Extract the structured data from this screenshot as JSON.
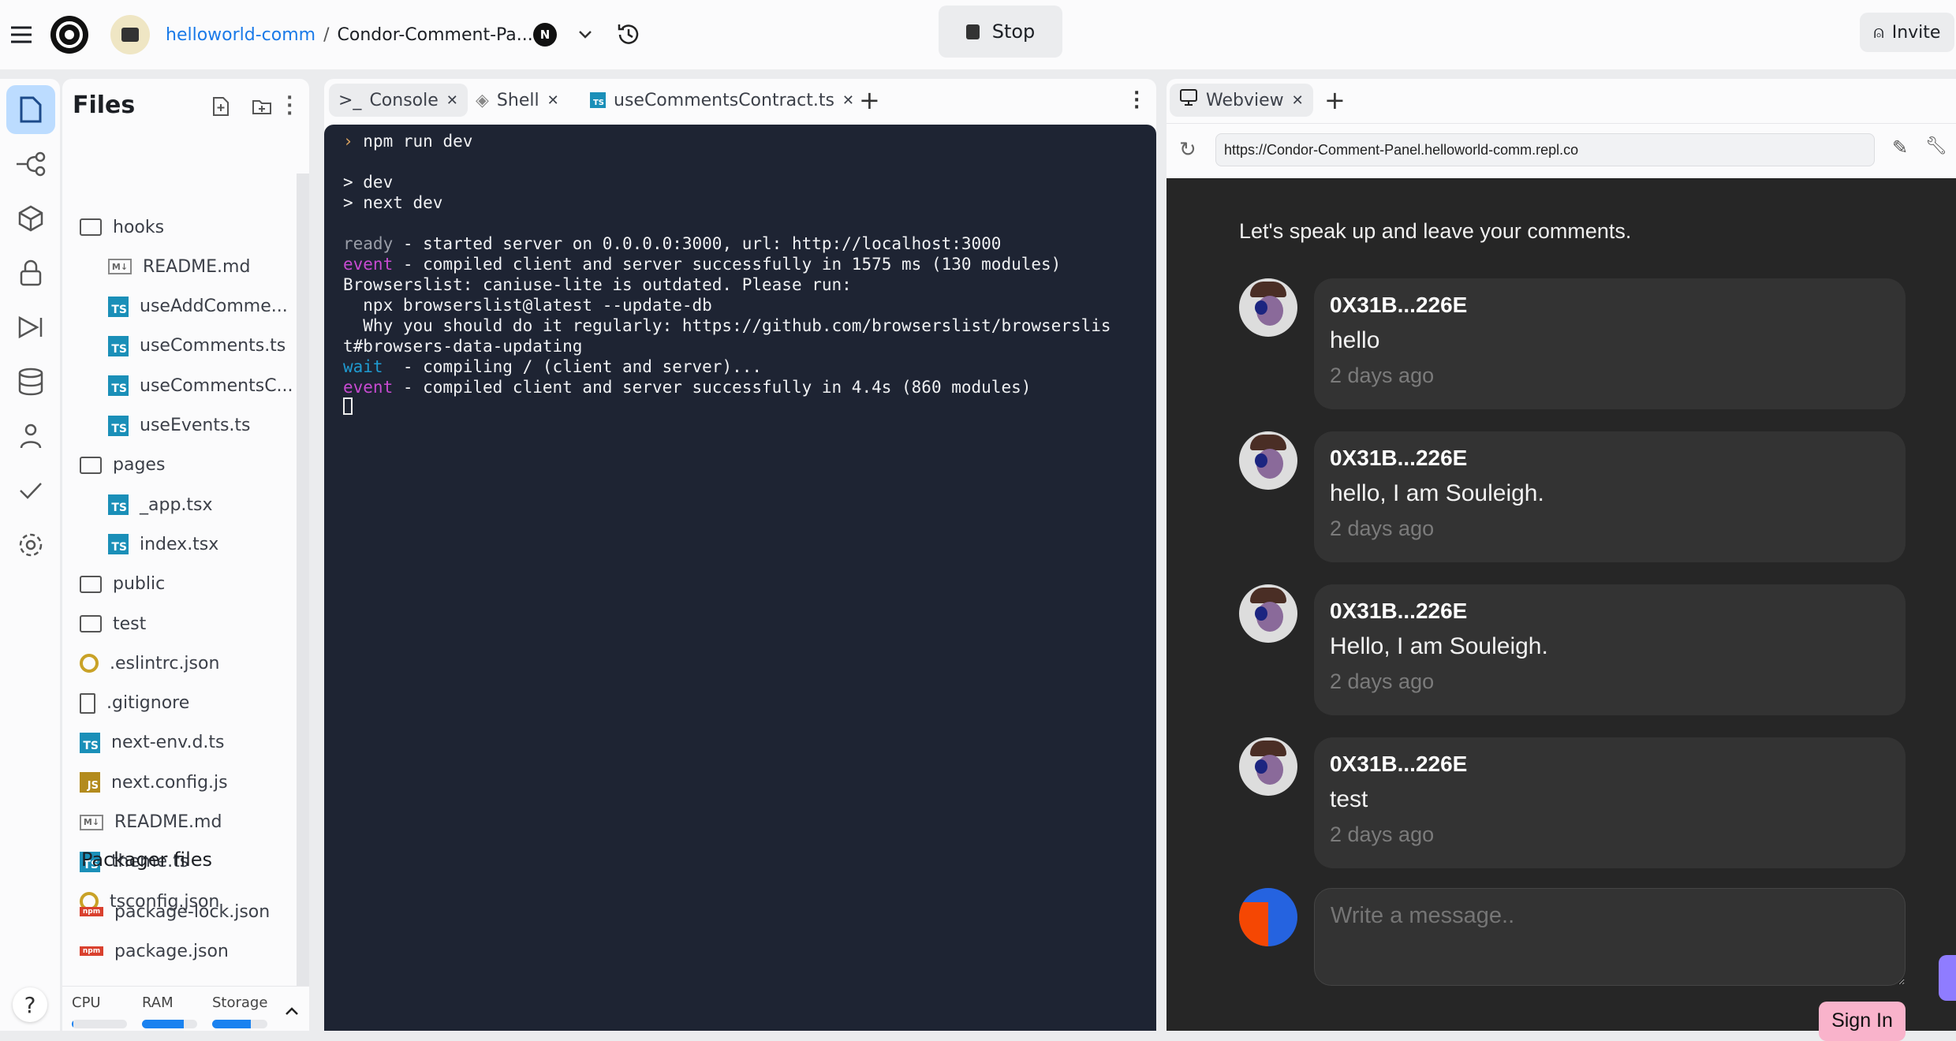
{
  "topbar": {
    "workspace": "helloworld-comm",
    "separator": "/",
    "repl_name": "Condor-Comment-Pa...",
    "nix_badge": "N",
    "stop_label": "Stop",
    "invite_label": "Invite"
  },
  "rail": {
    "icons": [
      "file-icon",
      "git-icon",
      "package-icon",
      "lock-icon",
      "debugger-icon",
      "database-icon",
      "user-icon",
      "check-icon",
      "settings-icon"
    ],
    "help": "?"
  },
  "files": {
    "title": "Files",
    "items": [
      {
        "name": "hooks",
        "type": "folder",
        "indent": 0
      },
      {
        "name": "README.md",
        "type": "md",
        "indent": 1
      },
      {
        "name": "useAddComme...",
        "type": "ts",
        "indent": 1
      },
      {
        "name": "useComments.ts",
        "type": "ts",
        "indent": 1
      },
      {
        "name": "useCommentsC...",
        "type": "ts",
        "indent": 1
      },
      {
        "name": "useEvents.ts",
        "type": "ts",
        "indent": 1
      },
      {
        "name": "pages",
        "type": "folder",
        "indent": 0
      },
      {
        "name": "_app.tsx",
        "type": "ts",
        "indent": 1
      },
      {
        "name": "index.tsx",
        "type": "ts",
        "indent": 1
      },
      {
        "name": "public",
        "type": "folder",
        "indent": 0
      },
      {
        "name": "test",
        "type": "folder",
        "indent": 0
      },
      {
        "name": ".eslintrc.json",
        "type": "json",
        "indent": 0
      },
      {
        "name": ".gitignore",
        "type": "file",
        "indent": 0
      },
      {
        "name": "next-env.d.ts",
        "type": "ts",
        "indent": 0
      },
      {
        "name": "next.config.js",
        "type": "js",
        "indent": 0
      },
      {
        "name": "README.md",
        "type": "md",
        "indent": 0
      },
      {
        "name": "theme.ts",
        "type": "ts",
        "indent": 0
      },
      {
        "name": "tsconfig.json",
        "type": "json",
        "indent": 0
      }
    ],
    "packager_title": "Packager files",
    "packager_items": [
      {
        "name": "package-lock.json"
      },
      {
        "name": "package.json"
      }
    ],
    "badges": {
      "md": "M↓",
      "ts": "TS",
      "js": "JS",
      "npm": "npm"
    }
  },
  "resources": {
    "cpu_label": "CPU",
    "ram_label": "RAM",
    "storage_label": "Storage",
    "cpu": 0.02,
    "ram": 0.75,
    "storage": 0.7
  },
  "console": {
    "tabs": [
      {
        "label": "Console",
        "icon": "terminal-icon",
        "active": true
      },
      {
        "label": "Shell",
        "icon": "shell-icon"
      },
      {
        "label": "useCommentsContract.ts",
        "icon": "ts-icon"
      }
    ],
    "lines": [
      {
        "parts": [
          {
            "t": "› ",
            "c": "#d9a25f"
          },
          {
            "t": "npm run dev"
          }
        ]
      },
      {
        "parts": [
          {
            "t": ""
          }
        ]
      },
      {
        "parts": [
          {
            "t": "> dev"
          }
        ]
      },
      {
        "parts": [
          {
            "t": "> next dev"
          }
        ]
      },
      {
        "parts": [
          {
            "t": ""
          }
        ]
      },
      {
        "parts": [
          {
            "t": "ready",
            "c": "#9a9ea8"
          },
          {
            "t": " - started server on 0.0.0.0:3000, url: http://localhost:3000"
          }
        ]
      },
      {
        "parts": [
          {
            "t": "event",
            "c": "#c74ad1"
          },
          {
            "t": " - compiled client and server successfully in 1575 ms (130 modules)"
          }
        ]
      },
      {
        "parts": [
          {
            "t": "Browserslist: caniuse-lite is outdated. Please run:"
          }
        ]
      },
      {
        "parts": [
          {
            "t": "  npx browserslist@latest --update-db"
          }
        ]
      },
      {
        "parts": [
          {
            "t": "  Why you should do it regularly: https://github.com/browserslist/browserslis"
          }
        ]
      },
      {
        "parts": [
          {
            "t": "t#browsers-data-updating"
          }
        ]
      },
      {
        "parts": [
          {
            "t": "wait",
            "c": "#1f9bd1"
          },
          {
            "t": "  - compiling / (client and server)..."
          }
        ]
      },
      {
        "parts": [
          {
            "t": "event",
            "c": "#c74ad1"
          },
          {
            "t": " - compiled client and server successfully in 4.4s (860 modules)"
          }
        ]
      }
    ]
  },
  "webview": {
    "tab_label": "Webview",
    "url": "https://Condor-Comment-Panel.helloworld-comm.repl.co",
    "heading": "Let's speak up and leave your comments.",
    "comments": [
      {
        "author": "0X31B...226E",
        "message": "hello",
        "time": "2 days ago"
      },
      {
        "author": "0X31B...226E",
        "message": "hello, I am Souleigh.",
        "time": "2 days ago"
      },
      {
        "author": "0X31B...226E",
        "message": "Hello, I am Souleigh.",
        "time": "2 days ago"
      },
      {
        "author": "0X31B...226E",
        "message": "test",
        "time": "2 days ago"
      }
    ],
    "input_placeholder": "Write a message..",
    "sign_in": "Sign In",
    "colors": {
      "bg": "#262626",
      "card": "#333333",
      "sign_in": "#f9b3cb"
    }
  }
}
